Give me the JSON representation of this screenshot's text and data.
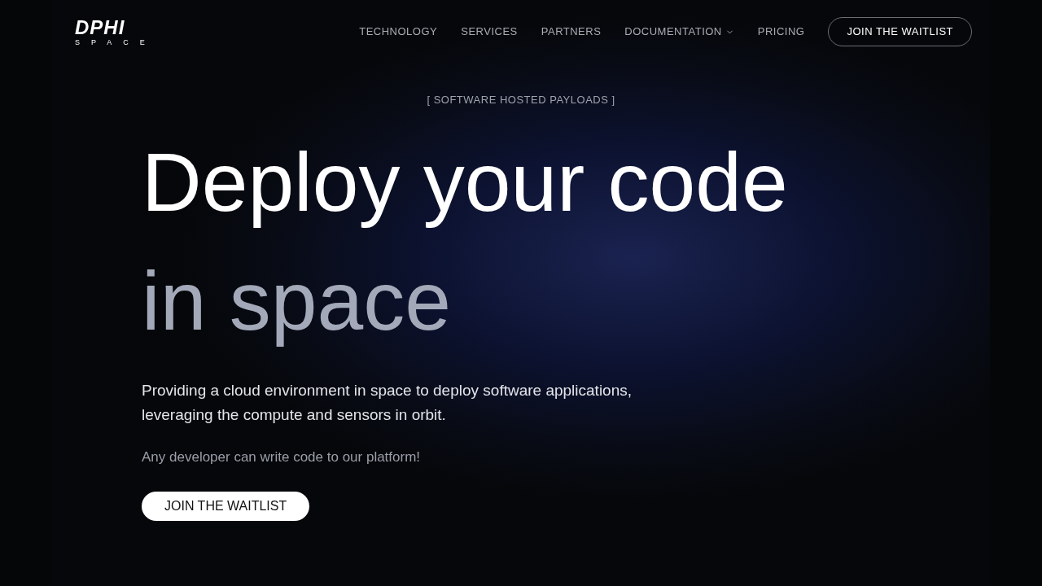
{
  "logo": {
    "wordmark": "DPHI",
    "subtitle": "SPACE"
  },
  "nav": {
    "items": [
      {
        "label": "TECHNOLOGY",
        "has_menu": false
      },
      {
        "label": "SERVICES",
        "has_menu": false
      },
      {
        "label": "PARTNERS",
        "has_menu": false
      },
      {
        "label": "DOCUMENTATION",
        "has_menu": true
      },
      {
        "label": "PRICING",
        "has_menu": false
      }
    ],
    "cta": "JOIN THE WAITLIST"
  },
  "hero": {
    "eyebrow": "[ SOFTWARE HOSTED PAYLOADS ]",
    "title_line_1": "Deploy your code",
    "title_line_2": "in space",
    "description": "Providing a cloud environment in space to deploy software applications, leveraging the compute and sensors in orbit.",
    "note": "Any developer can write code to our platform!",
    "cta": "JOIN THE WAITLIST"
  }
}
